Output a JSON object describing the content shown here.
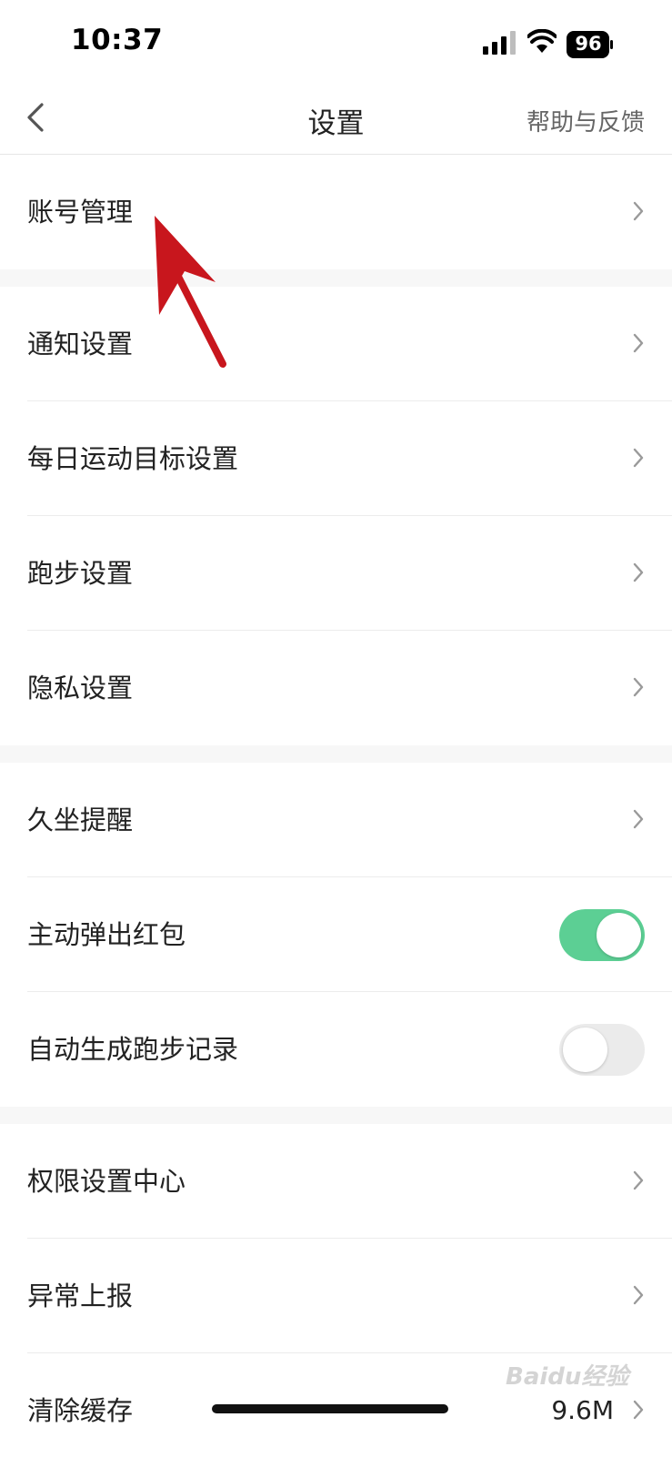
{
  "status": {
    "time": "10:37",
    "battery": "96"
  },
  "nav": {
    "title": "设置",
    "help": "帮助与反馈"
  },
  "groups": [
    {
      "items": [
        {
          "label": "账号管理"
        }
      ]
    },
    {
      "items": [
        {
          "label": "通知设置"
        },
        {
          "label": "每日运动目标设置"
        },
        {
          "label": "跑步设置"
        },
        {
          "label": "隐私设置"
        }
      ]
    },
    {
      "items": [
        {
          "label": "久坐提醒"
        },
        {
          "label": "主动弹出红包",
          "toggle": "on"
        },
        {
          "label": "自动生成跑步记录",
          "toggle": "off"
        }
      ]
    },
    {
      "items": [
        {
          "label": "权限设置中心"
        },
        {
          "label": "异常上报"
        },
        {
          "label": "清除缓存",
          "value": "9.6M"
        }
      ]
    }
  ],
  "watermark": "Baidu经验",
  "colors": {
    "toggle_on": "#5ccf94",
    "toggle_off": "#ebebeb",
    "annotation_arrow": "#c8161d"
  },
  "icons": {
    "back": "chevron-left-icon",
    "row_arrow": "chevron-right-icon"
  }
}
